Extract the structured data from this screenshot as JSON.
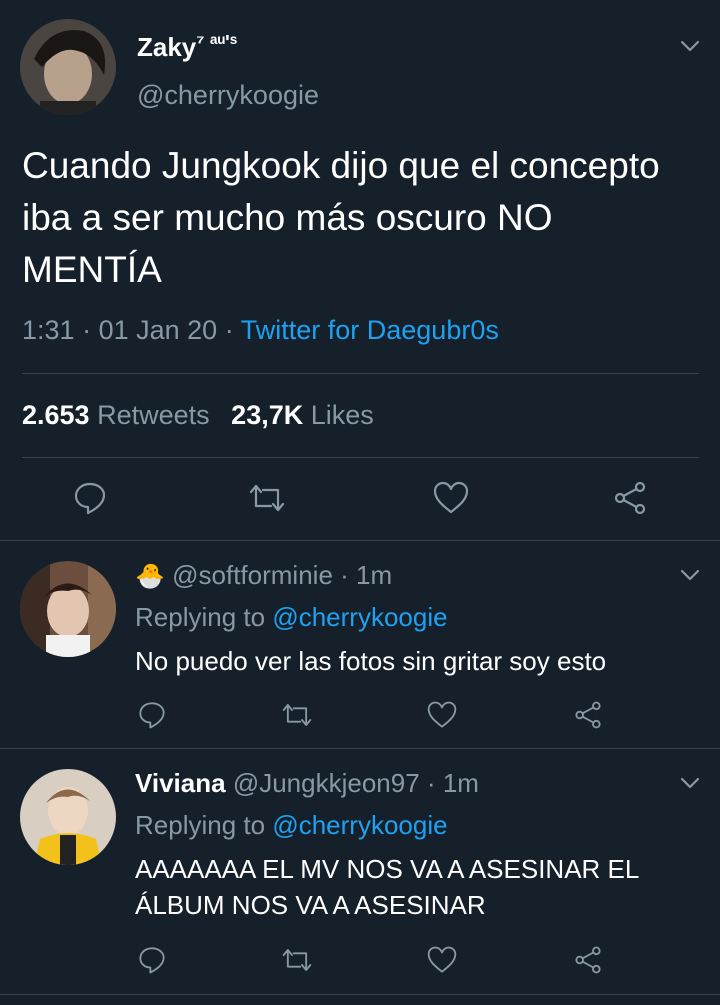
{
  "main_tweet": {
    "display_name": "Zaky",
    "name_suffix": "⁷ ᵃᵘ'ˢ",
    "handle": "@cherrykoogie",
    "text": "Cuando Jungkook dijo que el concepto iba a ser mucho más oscuro NO MENTÍA",
    "time": "1:31",
    "date": "01 Jan 20",
    "source": "Twitter for Daegubr0s",
    "retweets_count": "2.653",
    "retweets_label": "Retweets",
    "likes_count": "23,7K",
    "likes_label": "Likes"
  },
  "replies": [
    {
      "emoji": "🐣",
      "display_name": "",
      "handle": "@softforminie",
      "time": "1m",
      "replying_prefix": "Replying to",
      "replying_handle": "@cherrykoogie",
      "text": "No puedo ver las fotos sin gritar soy esto"
    },
    {
      "display_name": "Viviana",
      "handle": "@Jungkkjeon97",
      "time": "1m",
      "replying_prefix": "Replying to",
      "replying_handle": "@cherrykoogie",
      "text": "AAAAAAA EL MV NOS VA A ASESINAR EL ÁLBUM NOS VA A ASESINAR"
    }
  ],
  "separator": "·",
  "icons": [
    "chevron-down-icon",
    "reply-icon",
    "retweet-icon",
    "like-icon",
    "share-icon"
  ],
  "colors": {
    "background": "#15202b",
    "accent": "#1da1f2",
    "muted": "#8899a6",
    "divider": "#38444d"
  }
}
